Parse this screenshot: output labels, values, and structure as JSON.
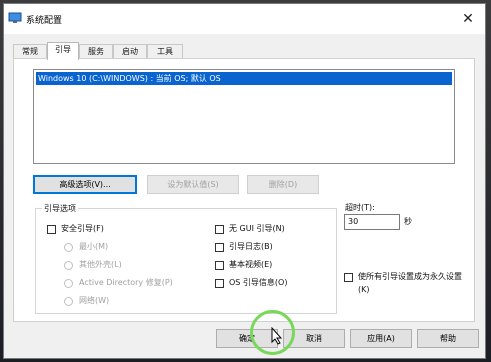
{
  "window": {
    "title": "系统配置",
    "close_glyph": "✕"
  },
  "tabs": [
    {
      "label": "常规"
    },
    {
      "label": "引导"
    },
    {
      "label": "服务"
    },
    {
      "label": "启动"
    },
    {
      "label": "工具"
    }
  ],
  "boot_list": {
    "entries": [
      "Windows 10 (C:\\WINDOWS) : 当前 OS; 默认 OS"
    ]
  },
  "boot_buttons": {
    "advanced": "高级选项(V)...",
    "set_default": "设为默认值(S)",
    "delete": "删除(D)"
  },
  "boot_options": {
    "title": "引导选项",
    "safe_boot": "安全引导(F)",
    "minimal": "最小(M)",
    "alternate_shell": "其他外壳(L)",
    "ad_repair": "Active Directory 修复(P)",
    "network": "网络(W)",
    "no_gui": "无 GUI 引导(N)",
    "boot_log": "引导日志(B)",
    "base_video": "基本视频(E)",
    "os_boot_info": "OS 引导信息(O)"
  },
  "timeout": {
    "label": "超时(T):",
    "value": "30",
    "unit": "秒"
  },
  "make_permanent": {
    "line1": "使所有引导设置成为永久设置",
    "line2": "(K)"
  },
  "footer": {
    "ok": "确定",
    "cancel": "取消",
    "apply": "应用(A)",
    "help": "帮助"
  }
}
